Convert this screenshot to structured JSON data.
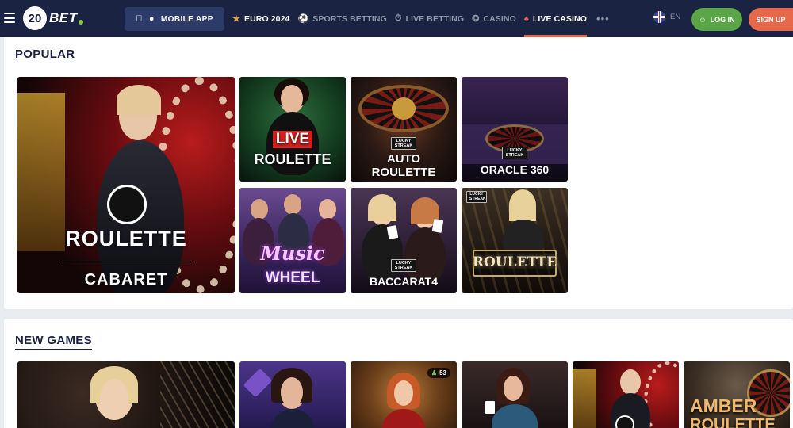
{
  "header": {
    "logo_number": "20",
    "logo_text": "BET",
    "mobile_app_label": "MOBILE APP",
    "nav": [
      {
        "label": "EURO 2024",
        "icon": "trophy-icon"
      },
      {
        "label": "SPORTS BETTING",
        "icon": "soccer-ball-icon"
      },
      {
        "label": "LIVE BETTING",
        "icon": "stopwatch-icon"
      },
      {
        "label": "CASINO",
        "icon": "roulette-wheel-icon"
      },
      {
        "label": "LIVE CASINO",
        "icon": "cards-icon",
        "active": true
      }
    ],
    "more_label": "•••",
    "language": "EN",
    "login_label": "LOG IN",
    "signup_label": "SIGN UP"
  },
  "popular": {
    "title": "POPULAR",
    "games": [
      {
        "name": "roulette-cabaret",
        "line1": "ROULETTE",
        "line2": "CABARET"
      },
      {
        "name": "live-roulette",
        "line1": "LIVE",
        "line2": "ROULETTE"
      },
      {
        "name": "auto-roulette",
        "badge": "LUCKY STREAK",
        "line1": "AUTO",
        "line2": "ROULETTE"
      },
      {
        "name": "oracle-360",
        "badge": "LUCKY STREAK",
        "line1": "ORACLE 360"
      },
      {
        "name": "music-wheel",
        "line1": "Music",
        "line2": "WHEEL"
      },
      {
        "name": "baccarat4",
        "badge": "LUCKY STREAK",
        "line1": "BACCARAT4"
      },
      {
        "name": "lucky-streak-roulette",
        "badge": "LUCKY STREAK",
        "line1": "ROULETTE"
      }
    ]
  },
  "new_games": {
    "title": "NEW GAMES",
    "player_count": "53",
    "partial_label": "AMBER",
    "partial_label_2": "ROULETTE"
  },
  "colors": {
    "header_bg": "#1a2342",
    "accent_orange": "#e8684b",
    "login_green": "#5aa545",
    "mobile_btn": "#2d3b6b"
  }
}
